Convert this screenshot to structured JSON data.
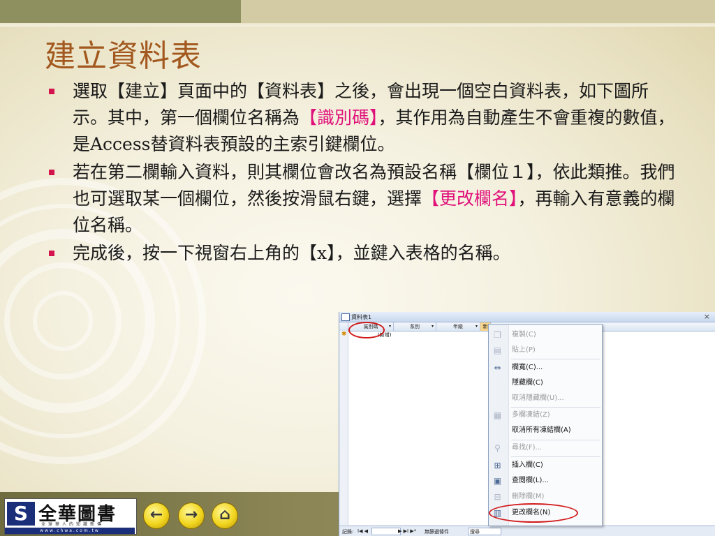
{
  "slide": {
    "title": "建立資料表",
    "bullets": [
      {
        "text_before": "選取【建立】頁面中的【資料表】之後，會出現一個空白資料表，如下圖所示。其中，第一個欄位名稱為",
        "highlight": "【識別碼】",
        "text_after": "，其作用為自動產生不會重複的數值，是Access替資料表預設的主索引鍵欄位。"
      },
      {
        "text_before": "若在第二欄輸入資料，則其欄位會改名為預設名稱【欄位１】，依此類推。我們也可選取某一個欄位，然後按滑鼠右鍵，選擇",
        "highlight": "【更改欄名】",
        "text_after": "，再輸入有意義的欄位名稱。"
      },
      {
        "text": "完成後，按一下視窗右上角的【x】，並鍵入表格的名稱。"
      }
    ],
    "highlight_color": "#e0117a",
    "bullet_color": "#d4144c",
    "title_color": "#a2581e"
  },
  "access_window": {
    "tab_title": "資料表1",
    "close": "×",
    "columns": [
      "識別碼",
      "系別",
      "年級",
      "新"
    ],
    "new_row_label": "(新增)",
    "status": {
      "record_label": "記錄:",
      "nav": "I◀ ◀",
      "nav_end": "▶ ▶I ▶*",
      "filter": "無篩選條件",
      "search": "搜尋"
    }
  },
  "context_menu": {
    "items": [
      {
        "label": "複製(C)",
        "icon": "copy-icon",
        "enabled": false
      },
      {
        "label": "貼上(P)",
        "icon": "paste-icon",
        "enabled": false
      },
      {
        "label": "欄寬(C)...",
        "icon": "column-width-icon",
        "enabled": true
      },
      {
        "label": "隱藏欄(C)",
        "icon": "",
        "enabled": true
      },
      {
        "label": "取消隱藏欄(U)...",
        "icon": "",
        "enabled": false
      },
      {
        "label": "多欄凍結(Z)",
        "icon": "freeze-icon",
        "enabled": false
      },
      {
        "label": "取消所有凍結欄(A)",
        "icon": "",
        "enabled": true
      },
      {
        "label": "尋找(F)...",
        "icon": "binoculars-icon",
        "enabled": false
      },
      {
        "label": "插入欄(C)",
        "icon": "insert-column-icon",
        "enabled": true
      },
      {
        "label": "查閱欄(L)...",
        "icon": "lookup-column-icon",
        "enabled": true
      },
      {
        "label": "刪除欄(M)",
        "icon": "delete-column-icon",
        "enabled": false
      },
      {
        "label": "更改欄名(N)",
        "icon": "rename-column-icon",
        "enabled": true
      }
    ]
  },
  "footer": {
    "logo_mark": "S",
    "brand": "全華圖書",
    "tagline": "全球華人的知識新傳",
    "url": "www.chwa.com.tw",
    "nav_buttons": [
      {
        "name": "back-button",
        "icon": "left-arrow-icon",
        "glyph": "←"
      },
      {
        "name": "forward-button",
        "icon": "right-arrow-icon",
        "glyph": "→"
      },
      {
        "name": "home-button",
        "icon": "home-icon",
        "glyph": "⌂"
      }
    ]
  }
}
